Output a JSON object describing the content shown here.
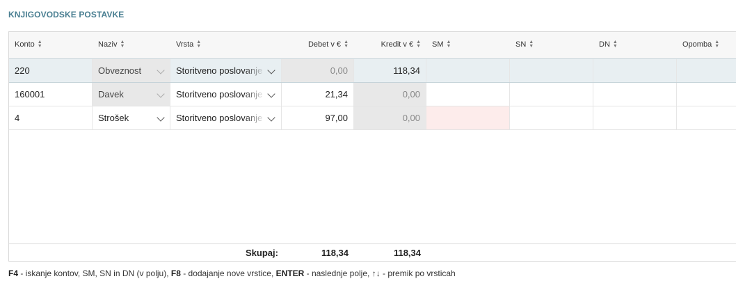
{
  "section_title": "KNJIGOVODSKE POSTAVKE",
  "columns": {
    "konto": "Konto",
    "naziv": "Naziv",
    "vrsta": "Vrsta",
    "debet": "Debet v €",
    "kredit": "Kredit v €",
    "sm": "SM",
    "sn": "SN",
    "dn": "DN",
    "opomba": "Opomba"
  },
  "rows": [
    {
      "konto": "220",
      "naziv": "Obveznost",
      "vrsta": "Storitveno poslovanje",
      "debet": "0,00",
      "kredit": "118,34",
      "sm": "",
      "sn": "",
      "dn": "",
      "opomba": ""
    },
    {
      "konto": "160001",
      "naziv": "Davek",
      "vrsta": "Storitveno poslovanje",
      "debet": "21,34",
      "kredit": "0,00",
      "sm": "",
      "sn": "",
      "dn": "",
      "opomba": ""
    },
    {
      "konto": "4",
      "naziv": "Strošek",
      "vrsta": "Storitveno poslovanje",
      "debet": "97,00",
      "kredit": "0,00",
      "sm": "",
      "sn": "",
      "dn": "",
      "opomba": ""
    }
  ],
  "totals": {
    "label": "Skupaj:",
    "debet": "118,34",
    "kredit": "118,34"
  },
  "hint": {
    "k1": "F4",
    "t1": " - iskanje kontov, SM, SN in DN (v polju), ",
    "k2": "F8",
    "t2": " - dodajanje nove vrstice, ",
    "k3": "ENTER",
    "t3": " - naslednje polje, ↑↓ - premik po vrsticah"
  },
  "colors": {
    "title": "#4a7f92",
    "selected_row": "#e8eff2",
    "readonly_cell": "#e8e8e8",
    "error_cell": "#fdeceb"
  }
}
